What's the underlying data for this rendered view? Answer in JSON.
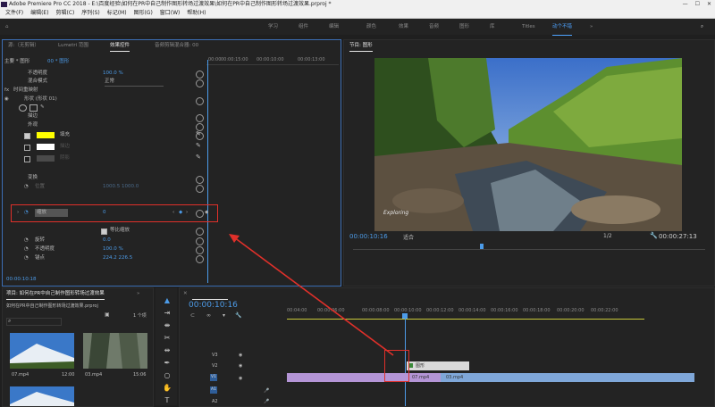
{
  "app": {
    "title": "Adobe Premiere Pro CC 2018 - E:\\百度经验\\如何在PR中自己制作图形转场过渡效果\\如何在PR中自己制作图形转场过渡效果.prproj *",
    "window_controls": [
      "—",
      "☐",
      "✕"
    ]
  },
  "menu": [
    "文件(F)",
    "编辑(E)",
    "剪辑(C)",
    "序列(S)",
    "标记(M)",
    "图形(G)",
    "窗口(W)",
    "帮助(H)"
  ],
  "workspaces": [
    "学习",
    "组件",
    "编辑",
    "颜色",
    "效果",
    "音频",
    "图形",
    "库",
    "Titles",
    "动个不错"
  ],
  "left_panel": {
    "tabs": [
      "源:（无剪辑）",
      "Lumetri 范围",
      "效果控件",
      "音频剪辑混合器: 00"
    ],
    "source_label": "主要 * 图形",
    "seq_label": "00 * 图形",
    "ruler": [
      "00:00",
      "00:00:15:00",
      "00:00:10:00",
      "00:00:13:00"
    ],
    "rows": {
      "opacity": "不透明度",
      "opacity_val": "100.0 %",
      "blend": "混合模式",
      "blend_val": "正常",
      "remap": "时间重映射",
      "shape": "形状 (形状 01)",
      "fill_group": "外观",
      "stroke": "描边",
      "fill": "填充",
      "fill_label": "填充",
      "stroke_label": "描边",
      "shadow_label": "阴影",
      "transform": "变换",
      "position": "位置",
      "position_val": "1000.5 1000.0",
      "scale": "缩放",
      "scale_val": "0",
      "uniform": "等比缩放",
      "rotation": "旋转",
      "rotation_val": "0.0",
      "opacity2": "不透明度",
      "opacity2_val": "100.0 %",
      "anchor": "锚点",
      "anchor_val": "224.2   226.5"
    },
    "timecode": "00:00:10:18"
  },
  "program": {
    "title": "节目: 图形",
    "timecode": "00:00:10:16",
    "fit": "适合",
    "ratio": "1/2",
    "duration": "00:00:27:13",
    "watermark": "Exploring"
  },
  "project": {
    "title": "项目: 如何在PR中自己制作图形转场过渡效果",
    "file": "如何在PR中自己制作图形转场过渡效果.prproj",
    "count": "1 个项",
    "items": [
      {
        "name": "07.mp4",
        "dur": "12:00"
      },
      {
        "name": "03.mp4",
        "dur": "15:06"
      }
    ]
  },
  "timeline": {
    "timecode": "00:00:10:16",
    "ruler": [
      "00:04:00",
      "00:00:06:00",
      "00:00:08:00",
      "00:00:10:00",
      "00:00:12:00",
      "00:00:14:00",
      "00:00:16:00",
      "00:00:18:00",
      "00:00:20:00",
      "00:00:22:00"
    ],
    "tracks": [
      "V3",
      "V2",
      "V1",
      "A1",
      "A2"
    ],
    "clips": {
      "graphic": "图形",
      "clip_a": "07.mp4",
      "clip_b": "03.mp4"
    }
  },
  "colors": {
    "accent": "#4ea3ff",
    "highlight_red": "#e0302a",
    "fill_yellow": "#ffff00",
    "playhead": "#4c9be8",
    "clip_purple": "#b495d6",
    "clip_blue": "#7fa7d9"
  }
}
